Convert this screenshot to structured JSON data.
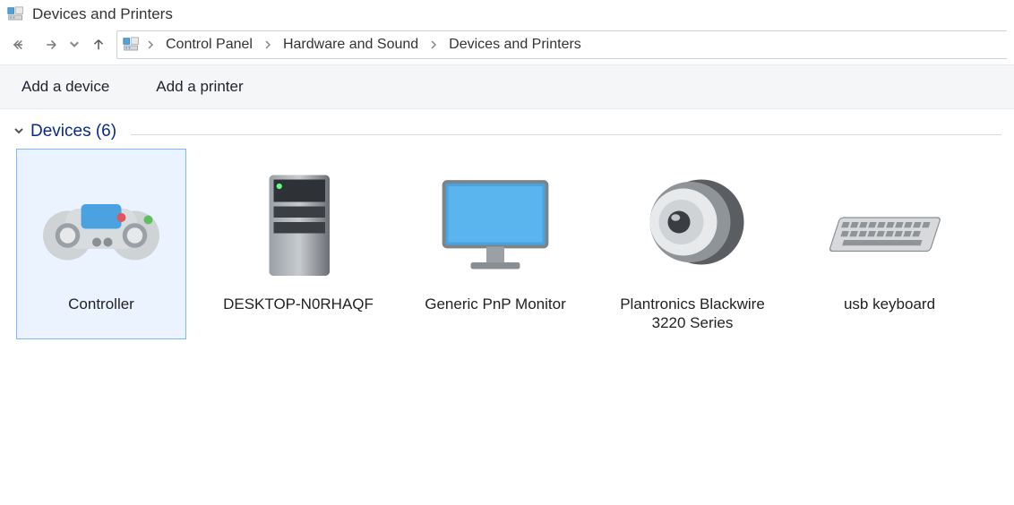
{
  "window": {
    "title": "Devices and Printers"
  },
  "breadcrumb": {
    "items": [
      {
        "label": "Control Panel"
      },
      {
        "label": "Hardware and Sound"
      },
      {
        "label": "Devices and Printers"
      }
    ]
  },
  "toolbar": {
    "add_device": "Add a device",
    "add_printer": "Add a printer"
  },
  "group": {
    "title": "Devices (6)",
    "count": 6
  },
  "devices": [
    {
      "label": "Controller",
      "icon": "gamepad",
      "selected": true
    },
    {
      "label": "DESKTOP-N0RHAQF",
      "icon": "desktop-tower",
      "selected": false
    },
    {
      "label": "Generic PnP Monitor",
      "icon": "monitor",
      "selected": false
    },
    {
      "label": "Plantronics Blackwire 3220 Series",
      "icon": "speaker",
      "selected": false
    },
    {
      "label": "usb keyboard",
      "icon": "keyboard",
      "selected": false
    }
  ]
}
